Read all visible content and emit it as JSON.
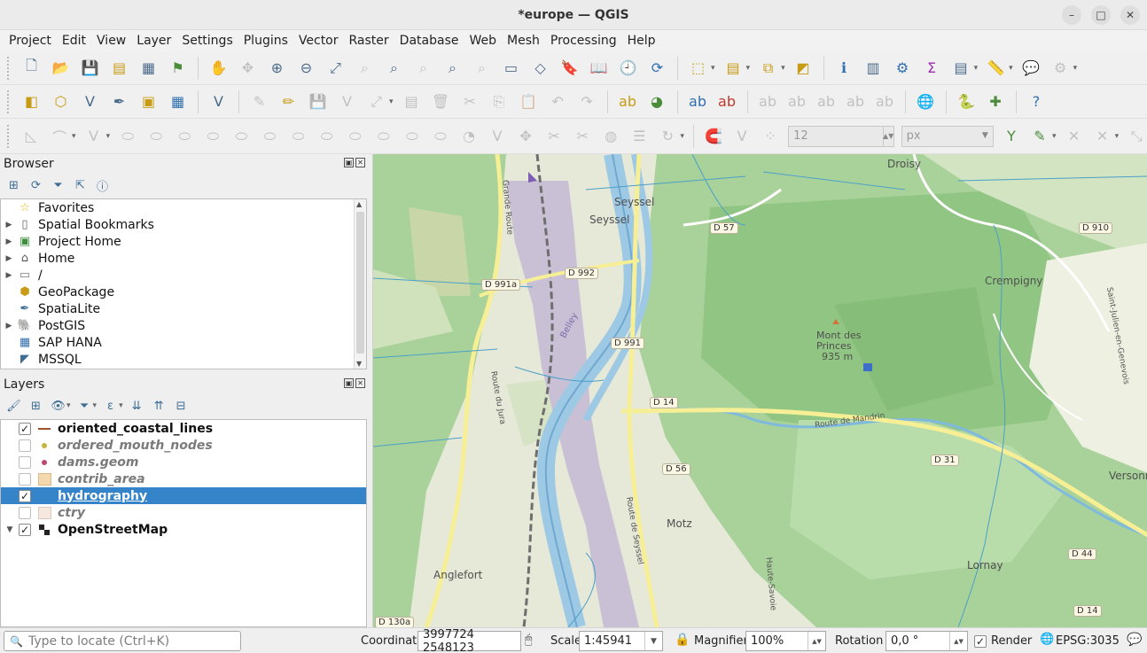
{
  "window": {
    "title": "*europe — QGIS",
    "controls": [
      "–",
      "□",
      "✕"
    ]
  },
  "menu": [
    "Project",
    "Edit",
    "View",
    "Layer",
    "Settings",
    "Plugins",
    "Vector",
    "Raster",
    "Database",
    "Web",
    "Mesh",
    "Processing",
    "Help"
  ],
  "digitizing": {
    "tolerance_value": "12",
    "tolerance_unit": "px"
  },
  "browser": {
    "title": "Browser",
    "items": [
      {
        "label": "Favorites",
        "icon": "star-icon",
        "expandable": false
      },
      {
        "label": "Spatial Bookmarks",
        "icon": "bookmark-icon",
        "expandable": true
      },
      {
        "label": "Project Home",
        "icon": "project-home-icon",
        "expandable": true
      },
      {
        "label": "Home",
        "icon": "home-icon",
        "expandable": true
      },
      {
        "label": "/",
        "icon": "folder-icon",
        "expandable": true
      },
      {
        "label": "GeoPackage",
        "icon": "geopackage-icon",
        "expandable": false
      },
      {
        "label": "SpatiaLite",
        "icon": "spatialite-icon",
        "expandable": false
      },
      {
        "label": "PostGIS",
        "icon": "postgis-icon",
        "expandable": true
      },
      {
        "label": "SAP HANA",
        "icon": "sap-hana-icon",
        "expandable": false
      },
      {
        "label": "MSSQL",
        "icon": "mssql-icon",
        "expandable": false
      }
    ]
  },
  "layers": {
    "title": "Layers",
    "items": [
      {
        "name": "oriented_coastal_lines",
        "checked": true,
        "italic": false,
        "selected": false,
        "symbol": "line",
        "color": "#a0522d"
      },
      {
        "name": "ordered_mouth_nodes",
        "checked": false,
        "italic": true,
        "selected": false,
        "symbol": "point",
        "color": "#c8b43c"
      },
      {
        "name": "dams.geom",
        "checked": false,
        "italic": true,
        "selected": false,
        "symbol": "point",
        "color": "#c0486e"
      },
      {
        "name": "contrib_area",
        "checked": false,
        "italic": true,
        "selected": false,
        "symbol": "polygon",
        "color": "#f5d9ae"
      },
      {
        "name": "hydrography",
        "checked": true,
        "italic": false,
        "selected": true,
        "symbol": "line",
        "color": "#3584c9"
      },
      {
        "name": "ctry",
        "checked": false,
        "italic": true,
        "selected": false,
        "symbol": "polygon",
        "color": "#f4e8df"
      },
      {
        "name": "OpenStreetMap",
        "checked": true,
        "italic": false,
        "selected": false,
        "symbol": "raster",
        "color": "#222222",
        "expandable": true
      }
    ]
  },
  "map": {
    "places": [
      "Droisy",
      "Seyssel",
      "Seyssel",
      "Crempigny",
      "Mont des",
      "Princes",
      "935 m",
      "Motz",
      "Anglefort",
      "Lornay",
      "Versonn",
      "Belley",
      "Route de Mandrin",
      "Grande Route",
      "Route du Jura",
      "Route de Seyssel",
      "Haute-Savoie",
      "Saint-Julien-en-Genevois"
    ],
    "roads": [
      "D 57",
      "D 910",
      "D 991a",
      "D 992",
      "D 991",
      "D 14",
      "D 56",
      "D 31",
      "D 44",
      "D 14",
      "D 130a"
    ]
  },
  "status": {
    "locator_placeholder": "Type to locate (Ctrl+K)",
    "coordinate_label": "Coordinate",
    "coordinate_value": "3997724 2548123",
    "scale_label": "Scale",
    "scale_value": "1:45941",
    "magnifier_label": "Magnifier",
    "magnifier_value": "100%",
    "rotation_label": "Rotation",
    "rotation_value": "0,0 °",
    "render_label": "Render",
    "render_checked": true,
    "crs": "EPSG:3035"
  }
}
